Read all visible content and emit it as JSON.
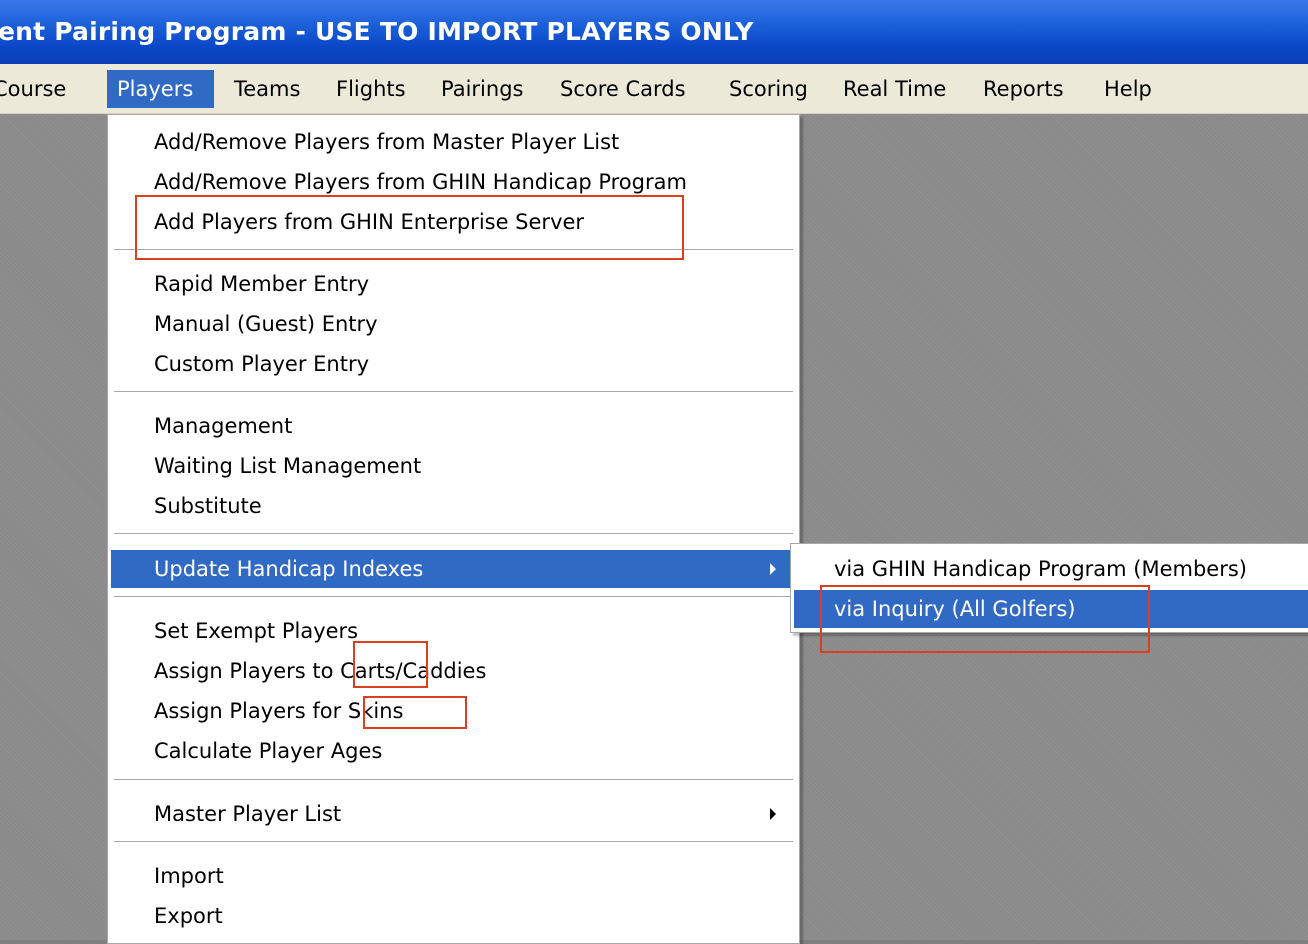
{
  "window": {
    "title": "ent Pairing Program - USE TO IMPORT PLAYERS ONLY"
  },
  "menubar": {
    "items": [
      "Course",
      "Players",
      "Teams",
      "Flights",
      "Pairings",
      "Score Cards",
      "Scoring",
      "Real Time",
      "Reports",
      "Help"
    ],
    "active": "Players"
  },
  "players_menu": {
    "group1": [
      "Add/Remove Players from Master Player List",
      "Add/Remove Players from GHIN Handicap Program",
      "Add Players from GHIN Enterprise Server"
    ],
    "group2": [
      "Rapid Member Entry",
      "Manual (Guest) Entry",
      "Custom Player Entry"
    ],
    "group3": [
      "Management",
      "Waiting List Management",
      "Substitute"
    ],
    "update_handicap": "Update Handicap Indexes",
    "group5": [
      "Set Exempt Players",
      "Assign Players to Carts/Caddies",
      "Assign Players for Skins",
      "Calculate Player Ages"
    ],
    "master_player_list": "Master Player List",
    "group7": [
      "Import",
      "Export"
    ]
  },
  "handicap_submenu": {
    "items": [
      "via GHIN Handicap Program (Members)",
      "via Inquiry (All Golfers)"
    ],
    "highlighted": "via Inquiry (All Golfers)"
  },
  "colors": {
    "titlebar": "#0a46c6",
    "menubar": "#ece9d8",
    "highlight": "#316ac5",
    "annotation": "#d9401e",
    "workspace": "#8a8a8a"
  }
}
